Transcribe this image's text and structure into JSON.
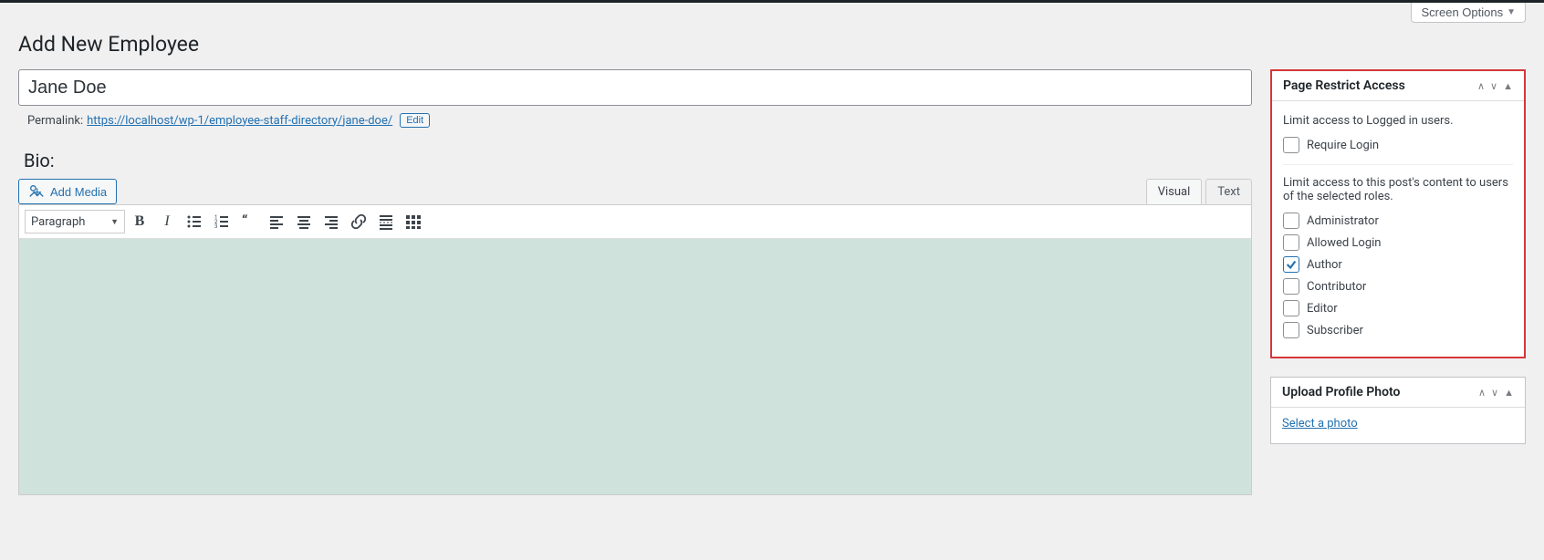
{
  "screen_options": "Screen Options",
  "page_title": "Add New Employee",
  "title_value": "Jane Doe",
  "permalink": {
    "label": "Permalink:",
    "base": "https://localhost/wp-1/employee-staff-directory/",
    "slug": "jane-doe/",
    "edit": "Edit"
  },
  "bio_label": "Bio:",
  "add_media": "Add Media",
  "tabs": {
    "visual": "Visual",
    "text": "Text"
  },
  "format_select": "Paragraph",
  "restrict_box": {
    "title": "Page Restrict Access",
    "limit_login_text": "Limit access to Logged in users.",
    "require_login": "Require Login",
    "limit_roles_text": "Limit access to this post's content to users of the selected roles.",
    "roles": [
      {
        "label": "Administrator",
        "checked": false
      },
      {
        "label": "Allowed Login",
        "checked": false
      },
      {
        "label": "Author",
        "checked": true
      },
      {
        "label": "Contributor",
        "checked": false
      },
      {
        "label": "Editor",
        "checked": false
      },
      {
        "label": "Subscriber",
        "checked": false
      }
    ]
  },
  "photo_box": {
    "title": "Upload Profile Photo",
    "link": "Select a photo"
  }
}
